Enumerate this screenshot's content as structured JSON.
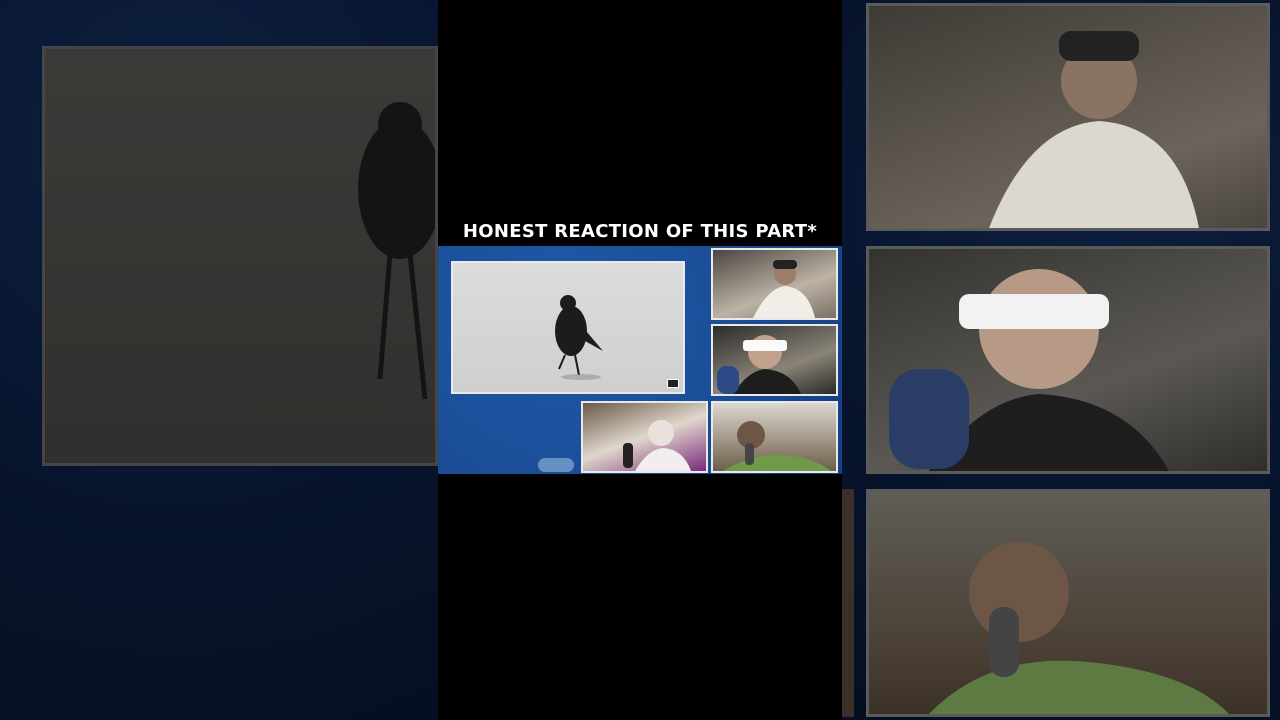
{
  "caption": "HONEST REACTION OF THIS PART*",
  "scene": {
    "main_clip_icon": "crow-on-beach-image",
    "reactors": [
      "webcam-reactor-1",
      "webcam-reactor-2",
      "webcam-reactor-3",
      "webcam-reactor-4"
    ]
  },
  "colors": {
    "collage_blue": "#1a4d97",
    "background_navy": "#0d2149",
    "caption_text": "#ffffff"
  }
}
